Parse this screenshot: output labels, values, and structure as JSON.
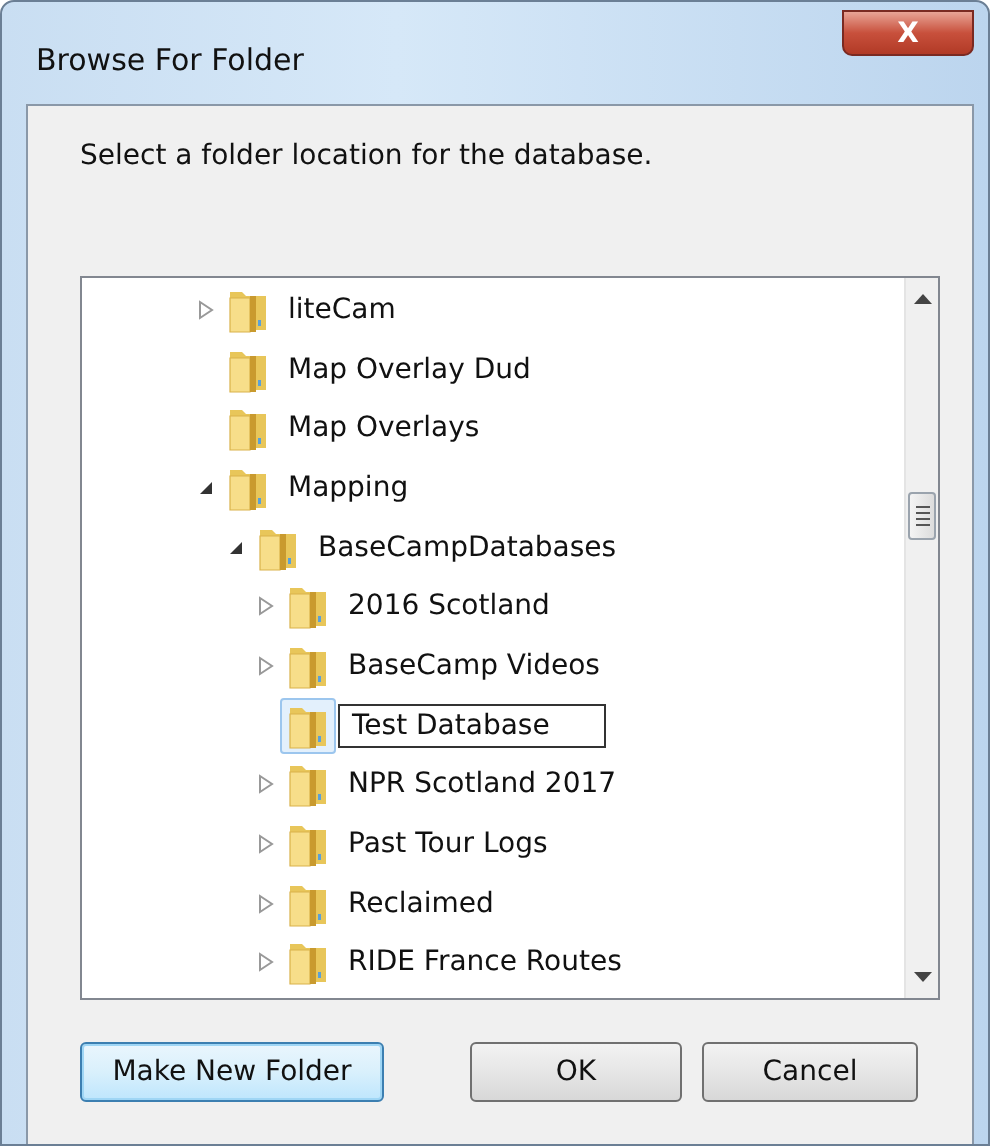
{
  "window": {
    "title": "Browse For Folder",
    "close": "X"
  },
  "message": "Select a folder location for the database.",
  "tree": [
    {
      "name": "liteCam",
      "expanded": false,
      "selected": false
    },
    {
      "name": "Map Overlay Dud",
      "selected": false
    },
    {
      "name": "Map Overlays",
      "selected": false
    },
    {
      "name": "Mapping",
      "expanded": true,
      "selected": false,
      "children": [
        {
          "name": "BaseCampDatabases",
          "expanded": true,
          "selected": false,
          "children": [
            {
              "name": "2016 Scotland",
              "expanded": false,
              "selected": false
            },
            {
              "name": "BaseCamp Videos",
              "expanded": false,
              "selected": false
            },
            {
              "name": "Test Database",
              "selected": true,
              "editing": true
            },
            {
              "name": "NPR Scotland 2017",
              "expanded": false,
              "selected": false
            },
            {
              "name": "Past Tour Logs",
              "expanded": false,
              "selected": false
            },
            {
              "name": "Reclaimed",
              "expanded": false,
              "selected": false
            },
            {
              "name": "RIDE France Routes",
              "expanded": false,
              "selected": false
            }
          ]
        }
      ]
    }
  ],
  "buttons": [
    {
      "label": "Make New Folder",
      "focused": true
    },
    {
      "label": "OK",
      "focused": false
    },
    {
      "label": "Cancel",
      "focused": false
    }
  ]
}
